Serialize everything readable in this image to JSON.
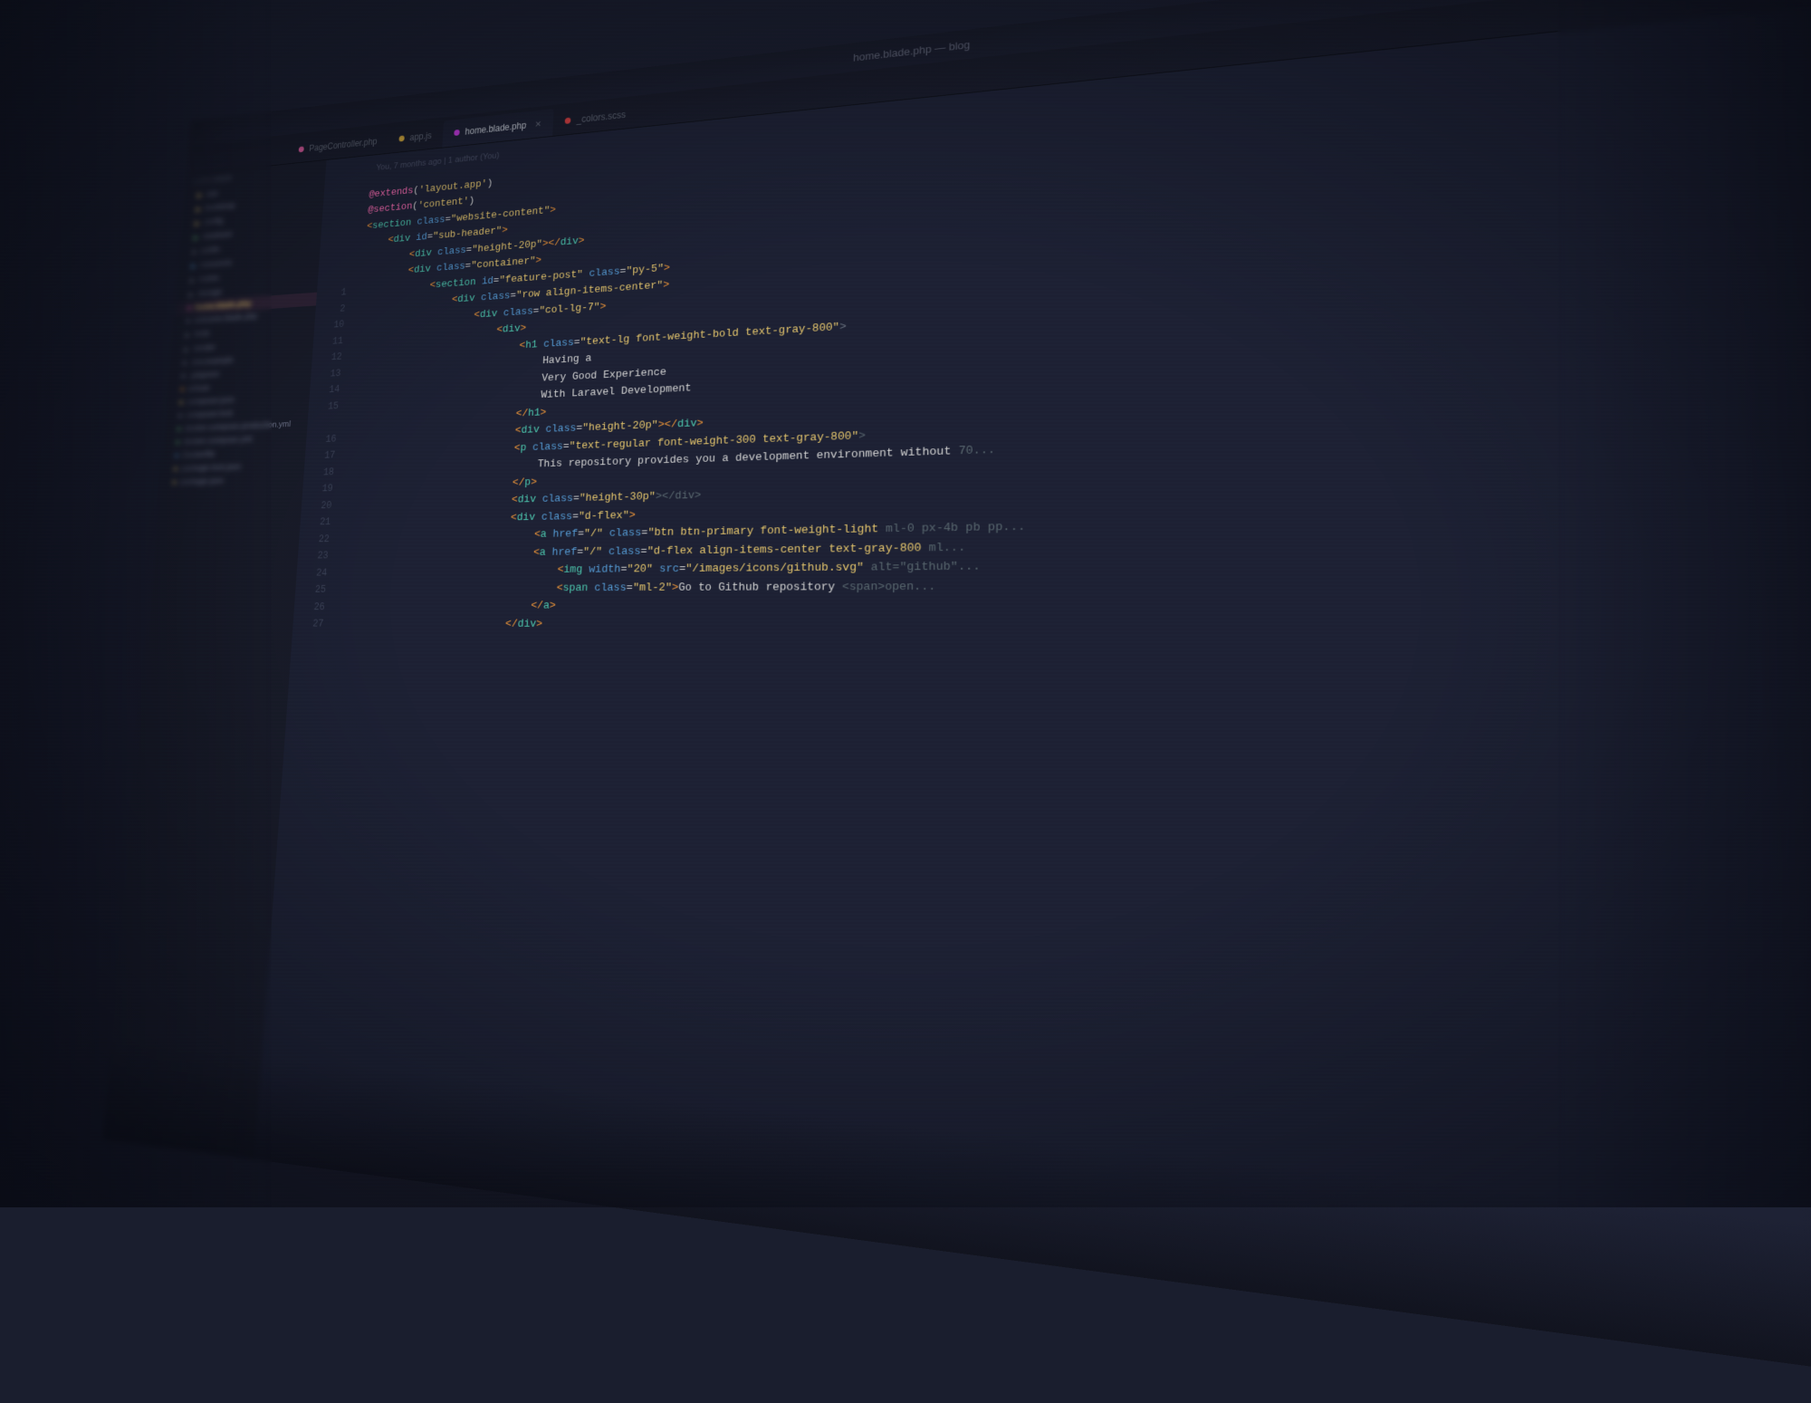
{
  "window": {
    "title": "home.blade.php — blog"
  },
  "tabs": [
    {
      "id": "tab-1",
      "label": "PageController.php",
      "dot_color": "pink",
      "active": false
    },
    {
      "id": "tab-2",
      "label": "app.js",
      "dot_color": "yellow",
      "active": false
    },
    {
      "id": "tab-3",
      "label": "home.blade.php",
      "dot_color": "magenta",
      "active": true,
      "closeable": true
    },
    {
      "id": "tab-4",
      "label": "_colors.scss",
      "dot_color": "red",
      "active": false
    }
  ],
  "blame": "You, 7 months ago | 1 author (You)",
  "sidebar": {
    "items": [
      {
        "label": "EXPLORER",
        "type": "header"
      },
      {
        "label": "app",
        "type": "folder",
        "level": 0
      },
      {
        "label": "bootstrap",
        "type": "folder",
        "level": 0
      },
      {
        "label": "config",
        "type": "folder",
        "level": 0
      },
      {
        "label": "database",
        "type": "folder",
        "level": 0
      },
      {
        "label": "public",
        "type": "folder",
        "level": 0
      },
      {
        "label": "resources",
        "type": "folder",
        "level": 0
      },
      {
        "label": "routes",
        "type": "folder",
        "level": 0
      },
      {
        "label": "storage",
        "type": "folder",
        "level": 0
      },
      {
        "label": "home.blade.php",
        "type": "file",
        "dot": "pink",
        "level": 1,
        "active": true
      },
      {
        "label": "welcome.blade.php",
        "type": "file",
        "dot": "gray",
        "level": 1
      },
      {
        "label": "tests",
        "type": "folder",
        "level": 0
      },
      {
        "label": "vendor",
        "type": "folder",
        "level": 0
      },
      {
        "label": ".env.example",
        "type": "file",
        "dot": "gray",
        "level": 0
      },
      {
        "label": ".gitignore",
        "type": "file",
        "dot": "gray",
        "level": 0
      },
      {
        "label": "artisan",
        "type": "file",
        "dot": "orange",
        "level": 0
      },
      {
        "label": "composer.json",
        "type": "file",
        "dot": "yellow",
        "level": 0
      },
      {
        "label": "composer.lock",
        "type": "file",
        "dot": "gray",
        "level": 0
      },
      {
        "label": "docker-compose.production.yml",
        "type": "file",
        "dot": "green",
        "level": 0
      },
      {
        "label": "docker-compose.yml",
        "type": "file",
        "dot": "green",
        "level": 0
      },
      {
        "label": "Dockerfile",
        "type": "file",
        "dot": "blue",
        "level": 0
      },
      {
        "label": "package-lock.json",
        "type": "file",
        "dot": "yellow",
        "level": 0
      },
      {
        "label": "package.json",
        "type": "file",
        "dot": "yellow",
        "level": 0
      }
    ]
  },
  "code": {
    "lines": [
      {
        "num": "",
        "content": "@extends('layout.app')"
      },
      {
        "num": "",
        "content": "@section('content')"
      },
      {
        "num": "",
        "content": "<section class=\"website-content\">"
      },
      {
        "num": "",
        "content": "    <div id=\"sub-header\">"
      },
      {
        "num": "",
        "content": "        <div class=\"height-20p\"></div>"
      },
      {
        "num": "",
        "content": "        <div class=\"container\">"
      },
      {
        "num": "1",
        "content": "            <section id=\"feature-post\" class=\"py-5\">"
      },
      {
        "num": "2",
        "content": "                <div class=\"row align-items-center\">"
      },
      {
        "num": "10",
        "content": "                    <div class=\"col-lg-7\">"
      },
      {
        "num": "11",
        "content": "                        <div>"
      },
      {
        "num": "12",
        "content": "                            <h1 class=\"text-lg font-weight-bold text-gray-800\">"
      },
      {
        "num": "13",
        "content": "                                Having a"
      },
      {
        "num": "14",
        "content": "                                Very Good Experience"
      },
      {
        "num": "15",
        "content": "                                With Laravel Development"
      },
      {
        "num": "",
        "content": "                            </h1>"
      },
      {
        "num": "16",
        "content": "                            <div class=\"height-20p\"></div>"
      },
      {
        "num": "17",
        "content": "                            <p class=\"text-regular font-weight-300 text-gray-800\">"
      },
      {
        "num": "18",
        "content": "                                This repository provides you a development environment without 70..."
      },
      {
        "num": "19",
        "content": "                            </p>"
      },
      {
        "num": "20",
        "content": "                            <div class=\"height-30p\"></div>"
      },
      {
        "num": "21",
        "content": "                            <div class=\"d-flex\">"
      },
      {
        "num": "22",
        "content": "                                <a href=\"/\" class=\"btn btn-primary font-weight-light ml-0 px-4b pb pp..."
      },
      {
        "num": "23",
        "content": "                                <a href=\"/\" class=\"d-flex align-items-center text-gray-800 ml..."
      },
      {
        "num": "24",
        "content": "                                    <img width=\"20\" src=\"/images/icons/github.svg\" alt=\"github\"..."
      },
      {
        "num": "25",
        "content": "                                    <span class=\"ml-2\">Go to Github repository <span>open..."
      },
      {
        "num": "26",
        "content": "                                </a>"
      },
      {
        "num": "27",
        "content": "                            </div>"
      }
    ]
  }
}
